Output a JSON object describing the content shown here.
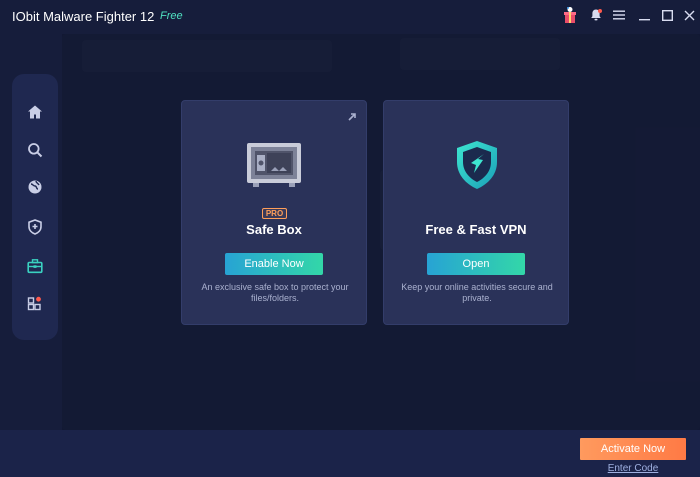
{
  "app": {
    "title": "IObit Malware Fighter 12",
    "edition": "Free"
  },
  "titlebar": {
    "icons": [
      "gift-icon",
      "bell-icon",
      "menu-icon",
      "minimize-icon",
      "maximize-icon",
      "close-icon"
    ]
  },
  "sidebar": {
    "items": [
      {
        "name": "home",
        "icon": "home-icon"
      },
      {
        "name": "scan",
        "icon": "search-icon"
      },
      {
        "name": "browser-protection",
        "icon": "globe-icon"
      },
      {
        "name": "protection",
        "icon": "shield-plus-icon"
      },
      {
        "name": "toolbox",
        "icon": "toolbox-icon",
        "active": true
      },
      {
        "name": "more",
        "icon": "grid-icon"
      }
    ]
  },
  "cards": [
    {
      "title": "Safe Box",
      "badge": "PRO",
      "button": "Enable Now",
      "description": "An exclusive safe box to protect your files/folders."
    },
    {
      "title": "Free & Fast VPN",
      "button": "Open",
      "description": "Keep your online activities secure and private."
    }
  ],
  "footer": {
    "activate": "Activate Now",
    "enter_code": "Enter Code"
  },
  "colors": {
    "background": "#161d3b",
    "card": "#2a3259",
    "accent_gradient_start": "#27a3d4",
    "accent_gradient_end": "#33d7a8",
    "activate": "#ff8a50",
    "edition": "#4fe0c0",
    "active_nav": "#3ad1c0"
  }
}
